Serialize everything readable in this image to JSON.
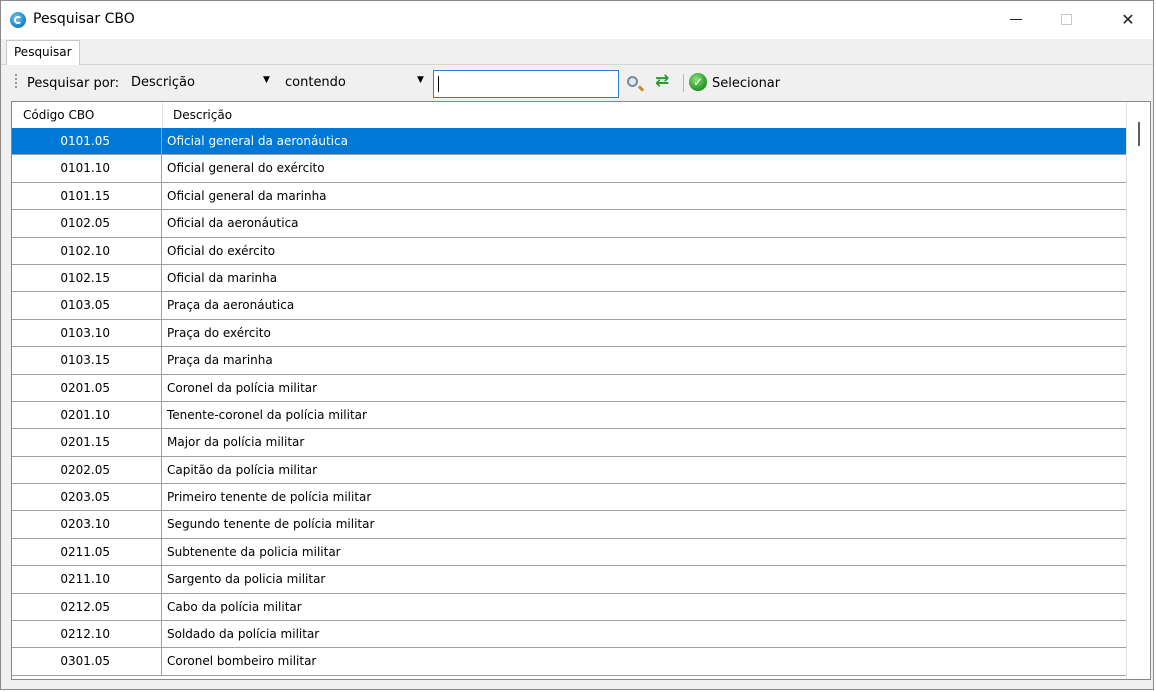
{
  "window": {
    "title": "Pesquisar CBO",
    "controls": [
      "minimize",
      "maximize",
      "close"
    ],
    "close_glyph": "✕"
  },
  "tabs": [
    {
      "label": "Pesquisar",
      "active": true
    }
  ],
  "toolbar": {
    "search_by_label": "Pesquisar por:",
    "field_combo": {
      "value": "Descrição"
    },
    "mode_combo": {
      "value": "contendo"
    },
    "search_input": {
      "value": "",
      "placeholder": ""
    },
    "icons": [
      "search-icon",
      "refresh-icon",
      "check-icon"
    ],
    "refresh_glyph": "⇄",
    "check_glyph": "✓",
    "select_label": "Selecionar"
  },
  "grid": {
    "columns": [
      "Código CBO",
      "Descrição"
    ],
    "selected_row": 0,
    "rows": [
      {
        "code": "0101.05",
        "desc": "Oficial general da aeronáutica"
      },
      {
        "code": "0101.10",
        "desc": "Oficial general do exército"
      },
      {
        "code": "0101.15",
        "desc": "Oficial general da marinha"
      },
      {
        "code": "0102.05",
        "desc": "Oficial da aeronáutica"
      },
      {
        "code": "0102.10",
        "desc": "Oficial do exército"
      },
      {
        "code": "0102.15",
        "desc": "Oficial da marinha"
      },
      {
        "code": "0103.05",
        "desc": "Praça da aeronáutica"
      },
      {
        "code": "0103.10",
        "desc": "Praça do exército"
      },
      {
        "code": "0103.15",
        "desc": "Praça da marinha"
      },
      {
        "code": "0201.05",
        "desc": "Coronel da polícia militar"
      },
      {
        "code": "0201.10",
        "desc": "Tenente-coronel da polícia militar"
      },
      {
        "code": "0201.15",
        "desc": "Major da polícia militar"
      },
      {
        "code": "0202.05",
        "desc": "Capitão da polícia militar"
      },
      {
        "code": "0203.05",
        "desc": "Primeiro tenente de polícia militar"
      },
      {
        "code": "0203.10",
        "desc": "Segundo tenente de polícia militar"
      },
      {
        "code": "0211.05",
        "desc": "Subtenente da policia militar"
      },
      {
        "code": "0211.10",
        "desc": "Sargento da policia militar"
      },
      {
        "code": "0212.05",
        "desc": "Cabo da polícia militar"
      },
      {
        "code": "0212.10",
        "desc": "Soldado da polícia militar"
      },
      {
        "code": "0301.05",
        "desc": "Coronel bombeiro militar"
      }
    ]
  },
  "colors": {
    "selection": "#0078d7",
    "accent_border": "#2f7bd6"
  }
}
